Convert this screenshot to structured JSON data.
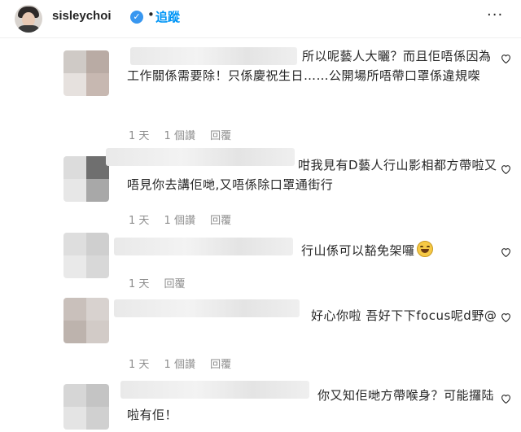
{
  "header": {
    "username": "sisleychoi",
    "verified_mark": "✓",
    "separator": "•",
    "follow_label": "追蹤",
    "more_label": "···"
  },
  "comments": [
    {
      "text": "所以呢藝人大曬？而且佢唔係因為工作關係需要除！只係慶祝生日……公開場所唔帶口罩係違規㗎",
      "time": "1 天",
      "likes": "1 個讚",
      "reply": "回覆"
    },
    {
      "text": "咁我見有D藝人行山影相都方帶啦又唔見你去講佢哋,又唔係除口罩通街行",
      "time": "1 天",
      "likes": "1 個讚",
      "reply": "回覆"
    },
    {
      "text": "行山係可以豁免架囉",
      "time": "1 天",
      "likes": "",
      "reply": "回覆"
    },
    {
      "text": "好心你啦 吾好下下focus呢d野@",
      "time": "1 天",
      "likes": "1 個讚",
      "reply": "回覆"
    },
    {
      "text": "你又知佢哋方帶喉身？可能攞陆啦有佢！",
      "time": "",
      "likes": "",
      "reply": ""
    }
  ],
  "colors": {
    "follow": "#0095f6",
    "verified": "#3897f0",
    "meta": "#8e8e8e"
  },
  "icons": [
    "verified-icon",
    "more-options-icon",
    "heart-icon",
    "laughing-emoji-icon"
  ]
}
